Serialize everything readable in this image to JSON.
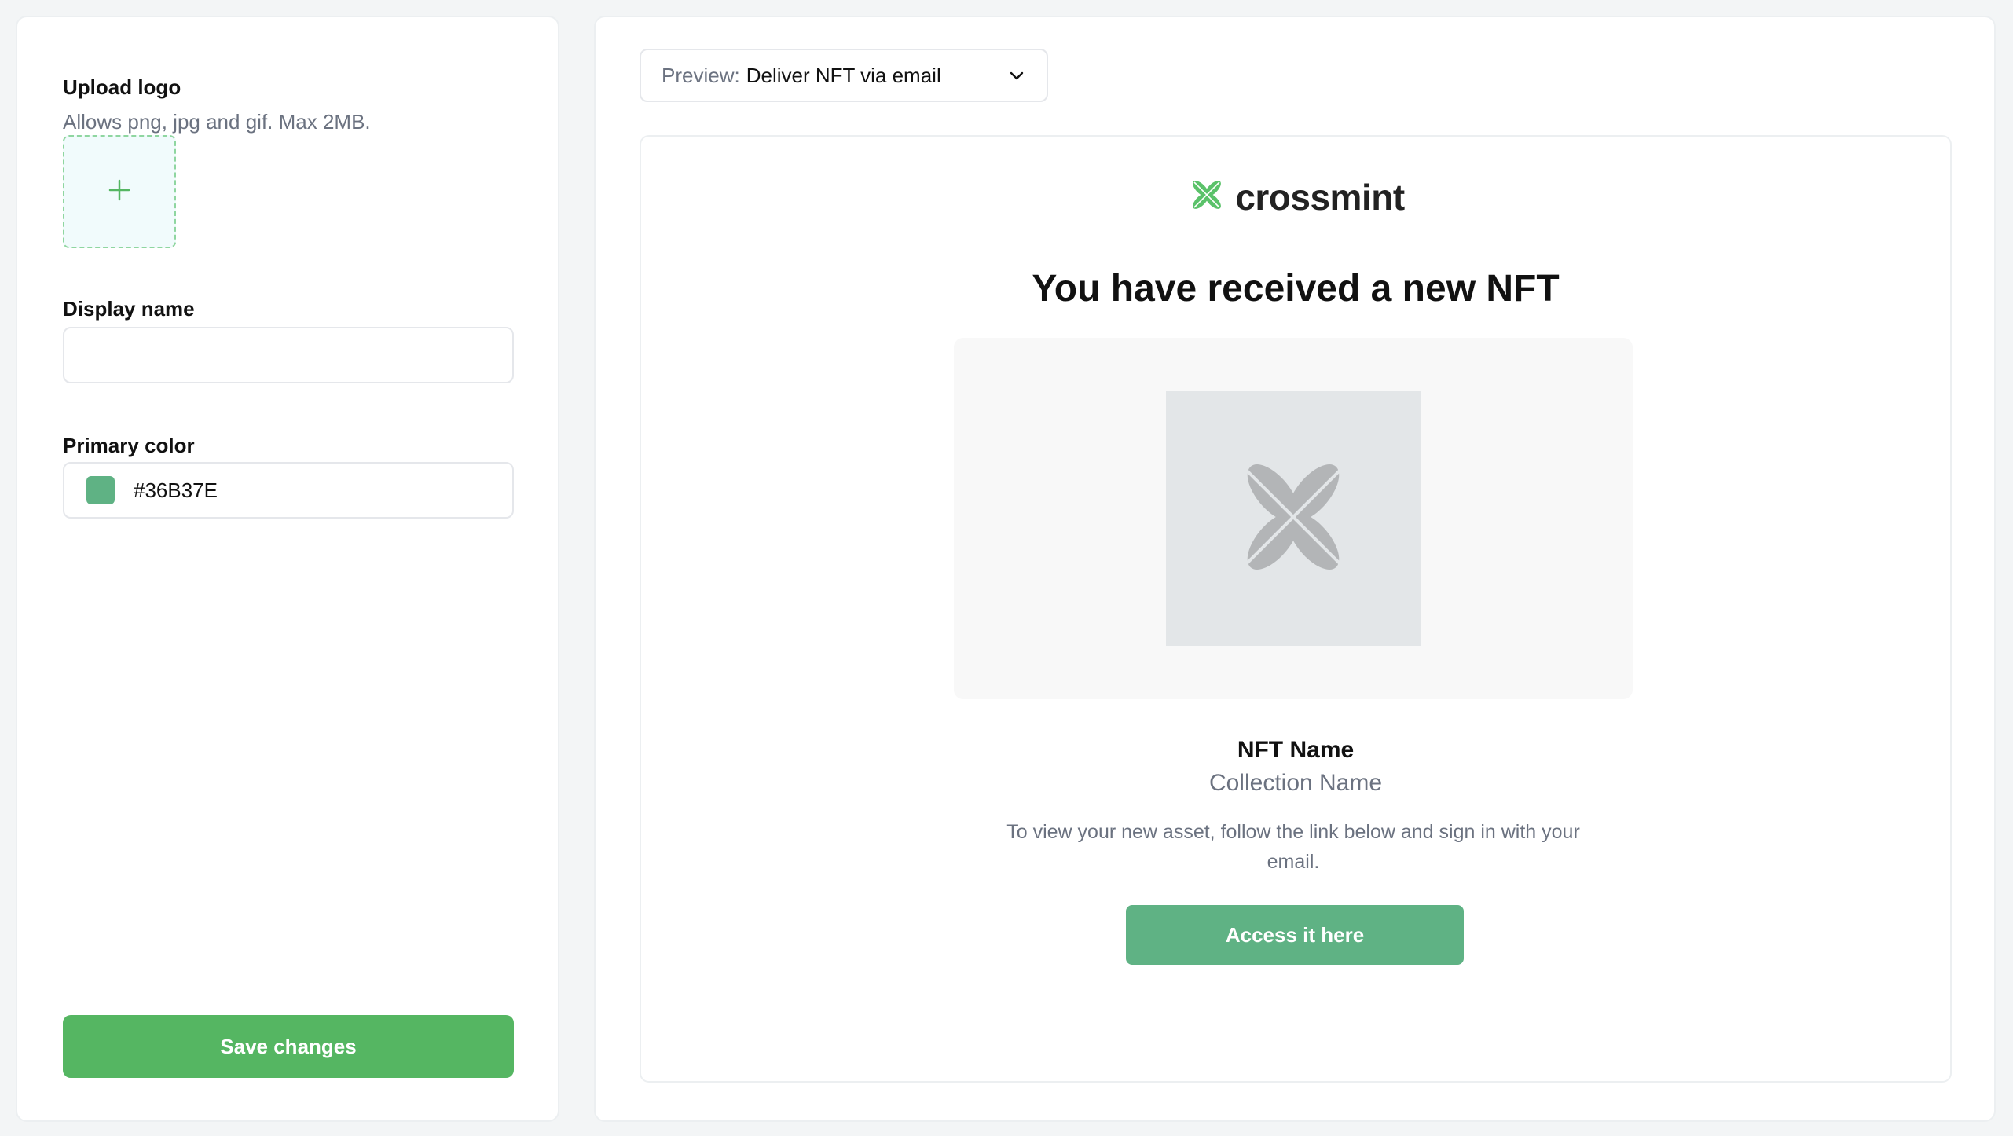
{
  "settings": {
    "upload_logo_label": "Upload logo",
    "upload_logo_hint": "Allows png, jpg and gif. Max 2MB.",
    "display_name_label": "Display name",
    "display_name_value": "",
    "primary_color_label": "Primary color",
    "primary_color_value": "#36B37E",
    "save_label": "Save changes"
  },
  "preview": {
    "select_prefix": "Preview:",
    "select_value": "Deliver NFT via email"
  },
  "email": {
    "brand_name": "crossmint",
    "headline": "You have received a new NFT",
    "nft_name": "NFT Name",
    "collection_name": "Collection Name",
    "body": "To view your new asset, follow the link below and sign in with your email.",
    "cta_label": "Access it here"
  },
  "colors": {
    "swatch": "#5fb284",
    "save_button": "#55b662",
    "cta_button": "#5fb284",
    "brand_icon": "#5bc26a",
    "placeholder_icon": "#b3b5b7"
  }
}
